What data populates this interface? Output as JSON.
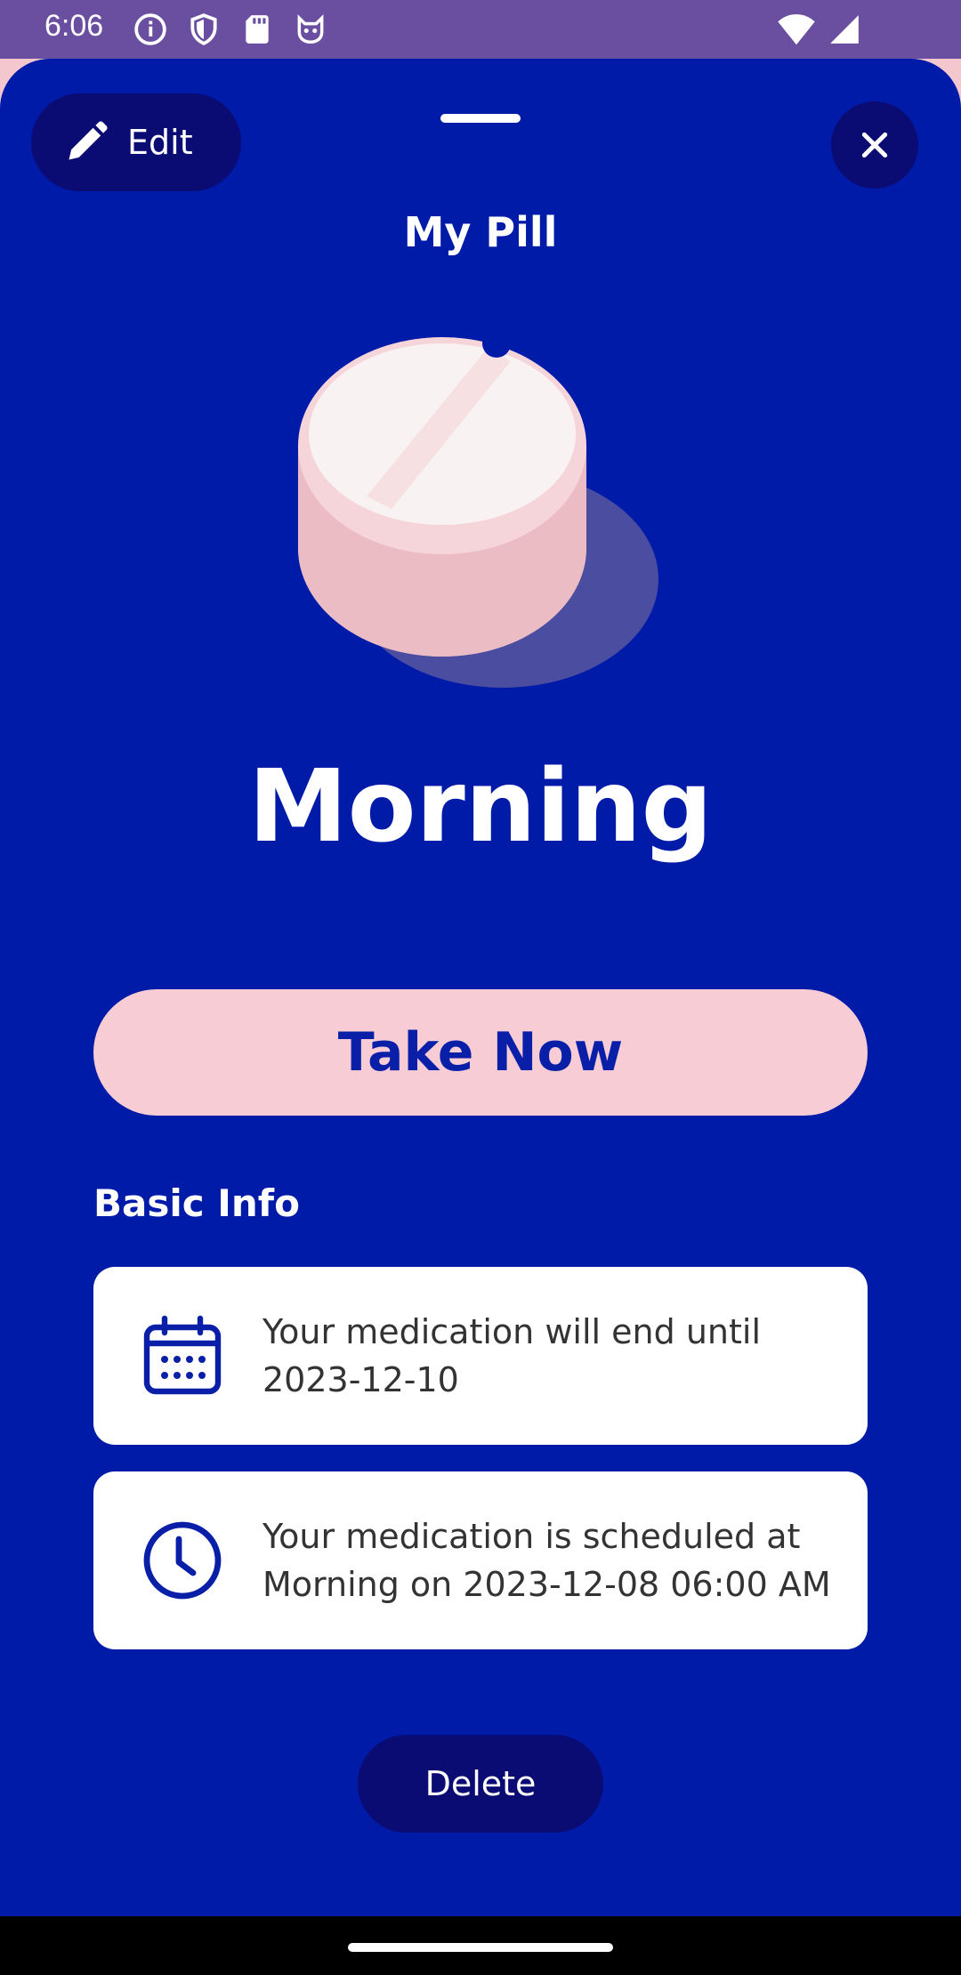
{
  "status_bar": {
    "time": "6:06",
    "icons": [
      "info-icon",
      "shield-icon",
      "sd-card-icon",
      "cat-icon",
      "wifi-icon",
      "signal-icon"
    ]
  },
  "header": {
    "edit_label": "Edit",
    "title": "My Pill"
  },
  "main": {
    "time_of_day": "Morning",
    "take_now_label": "Take Now",
    "section_title": "Basic Info",
    "info_cards": [
      {
        "icon": "calendar-icon",
        "text": "Your medication will end until 2023-12-10"
      },
      {
        "icon": "clock-icon",
        "text": "Your medication is scheduled at Morning on 2023-12-08 06:00 AM"
      }
    ],
    "delete_label": "Delete"
  },
  "colors": {
    "sheet_bg": "#001ba8",
    "accent_dark": "#0b0b74",
    "pill_pink": "#f7ccd4",
    "status_bar": "#6a4fa0"
  }
}
